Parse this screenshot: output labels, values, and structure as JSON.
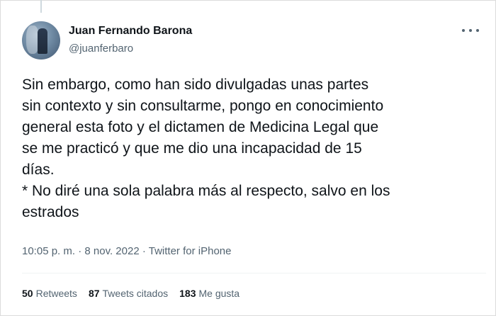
{
  "tweet": {
    "author_name": "Juan Fernando Barona",
    "author_handle": "@juanferbaro",
    "text": "Sin embargo, como han sido divulgadas unas partes\nsin contexto y sin consultarme, pongo en conocimiento\ngeneral esta foto y el dictamen de Medicina Legal que\nse me practicó y que me dio una incapacidad de 15\ndías.\n* No diré una sola palabra más al respecto, salvo en los\nestrados",
    "time": "10:05 p. m.",
    "separator": " · ",
    "date": "8 nov. 2022",
    "source": "Twitter for iPhone",
    "more_icon": "more-horizontal-icon"
  },
  "stats": {
    "retweets_count": "50",
    "retweets_label": "Retweets",
    "quotes_count": "87",
    "quotes_label": "Tweets citados",
    "likes_count": "183",
    "likes_label": "Me gusta"
  },
  "colors": {
    "text_primary": "#0f1419",
    "text_secondary": "#536471",
    "divider": "#eff3f4"
  }
}
